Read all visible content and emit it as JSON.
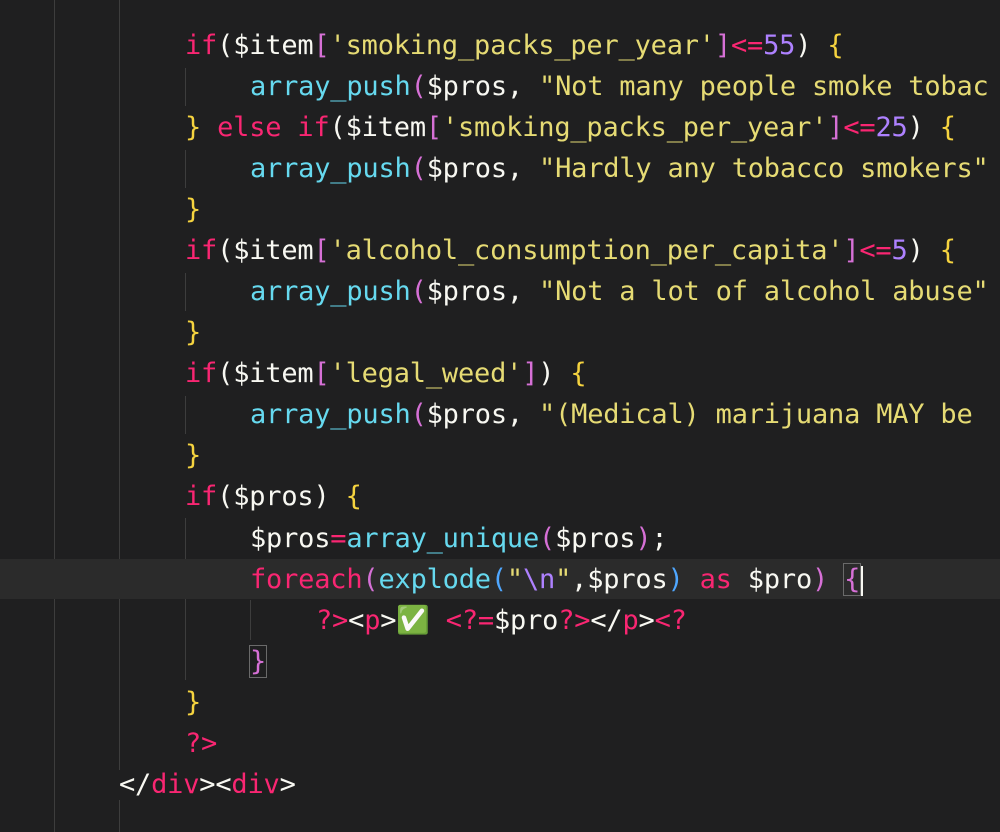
{
  "code": {
    "l1": {
      "if": "if",
      "p1": "(",
      "v": "$item",
      "b1": "[",
      "s": "'smoking_packs_per_year'",
      "b2": "]",
      "op": "<=",
      "n": "55",
      "p2": ")",
      "ob": "{"
    },
    "l2": {
      "fn": "array_push",
      "p1": "(",
      "v": "$pros",
      "c": ", ",
      "s": "\"Not many people smoke tobac"
    },
    "l3": {
      "cb": "}",
      "els": " else ",
      "if": "if",
      "p1": "(",
      "v": "$item",
      "b1": "[",
      "s": "'smoking_packs_per_year'",
      "b2": "]",
      "op": "<=",
      "n": "25",
      "p2": ")",
      "ob": "{"
    },
    "l4": {
      "fn": "array_push",
      "p1": "(",
      "v": "$pros",
      "c": ", ",
      "s": "\"Hardly any tobacco smokers\""
    },
    "l5": {
      "cb": "}"
    },
    "l6": {
      "if": "if",
      "p1": "(",
      "v": "$item",
      "b1": "[",
      "s": "'alcohol_consumption_per_capita'",
      "b2": "]",
      "op": "<=",
      "n": "5",
      "p2": ")",
      "ob": "{"
    },
    "l7": {
      "fn": "array_push",
      "p1": "(",
      "v": "$pros",
      "c": ", ",
      "s": "\"Not a lot of alcohol abuse\""
    },
    "l8": {
      "cb": "}"
    },
    "l9": {
      "if": "if",
      "p1": "(",
      "v": "$item",
      "b1": "[",
      "s": "'legal_weed'",
      "b2": "]",
      "p2": ")",
      "ob": "{"
    },
    "l10": {
      "fn": "array_push",
      "p1": "(",
      "v": "$pros",
      "c": ", ",
      "s": "\"(Medical) marijuana MAY be"
    },
    "l11": {
      "cb": "}"
    },
    "l12": {
      "if": "if",
      "p1": "(",
      "v": "$pros",
      "p2": ")",
      "ob": "{"
    },
    "l13": {
      "v": "$pros",
      "op": "=",
      "fn": "array_unique",
      "p1": "(",
      "v2": "$pros",
      "p2": ")",
      "semi": ";"
    },
    "l14": {
      "kw": "foreach",
      "p1": "(",
      "fn": "explode",
      "p2": "(",
      "s1": "\"",
      "esc": "\\n",
      "s2": "\"",
      "c": ",",
      "v": "$pros",
      "p3": ")",
      "as": " as ",
      "v2": "$pro",
      "p4": ")",
      "ob": "{"
    },
    "l15": {
      "close": "?>",
      "lt": "<",
      "tag": "p",
      "gt": ">",
      "emoji": "✅",
      "sp": " ",
      "open": "<?=",
      "v": "$pro",
      "close2": "?>",
      "lt2": "</",
      "tag2": "p",
      "gt2": ">",
      "open2": "<?"
    },
    "l16": {
      "cb": "}"
    },
    "l17": {
      "cb": "}"
    },
    "l18": {
      "close": "?>"
    },
    "l19": {
      "lt": "</",
      "tag": "div",
      "gt": ">",
      "lt2": "<",
      "tag2": "div",
      "gt2": ">"
    }
  }
}
